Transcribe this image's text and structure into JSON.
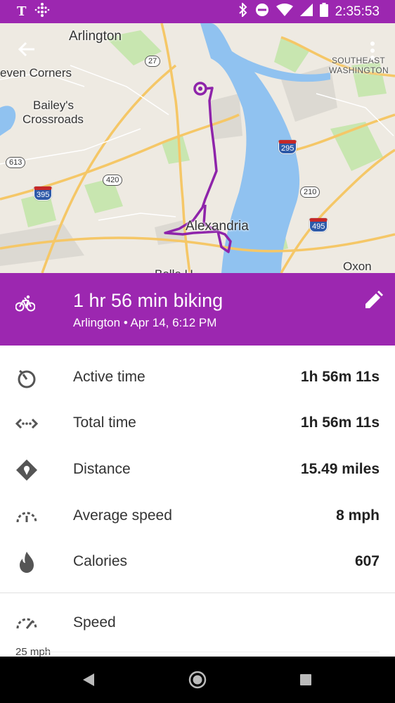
{
  "status_bar": {
    "time": "2:35:53",
    "carrier": "T"
  },
  "map": {
    "labels": {
      "arlington": "Arlington",
      "seven_corners": "even Corners",
      "baileys": "Bailey's",
      "crossroads": "Crossroads",
      "alexandria": "Alexandria",
      "southeast": "SOUTHEAST",
      "washington": "WASHINGTON",
      "oxon": "Oxon",
      "bottom_cut": "Belle H"
    },
    "shields": {
      "r27": "27",
      "r295": "295",
      "r613": "613",
      "r395": "395",
      "r420": "420",
      "r210": "210",
      "r495": "495"
    },
    "route_color": "#8e24aa"
  },
  "activity": {
    "title": "1 hr 56 min biking",
    "subtitle": "Arlington • Apr 14, 6:12 PM",
    "accent": "#9c27b0"
  },
  "stats": [
    {
      "icon": "timer-icon",
      "label": "Active time",
      "value": "1h 56m 11s"
    },
    {
      "icon": "total-time-icon",
      "label": "Total time",
      "value": "1h 56m 11s"
    },
    {
      "icon": "distance-icon",
      "label": "Distance",
      "value": "15.49 miles"
    },
    {
      "icon": "speedometer-icon",
      "label": "Average speed",
      "value": "8 mph"
    },
    {
      "icon": "flame-icon",
      "label": "Calories",
      "value": "607"
    }
  ],
  "speed_section": {
    "label": "Speed",
    "axis_top": "25 mph"
  }
}
